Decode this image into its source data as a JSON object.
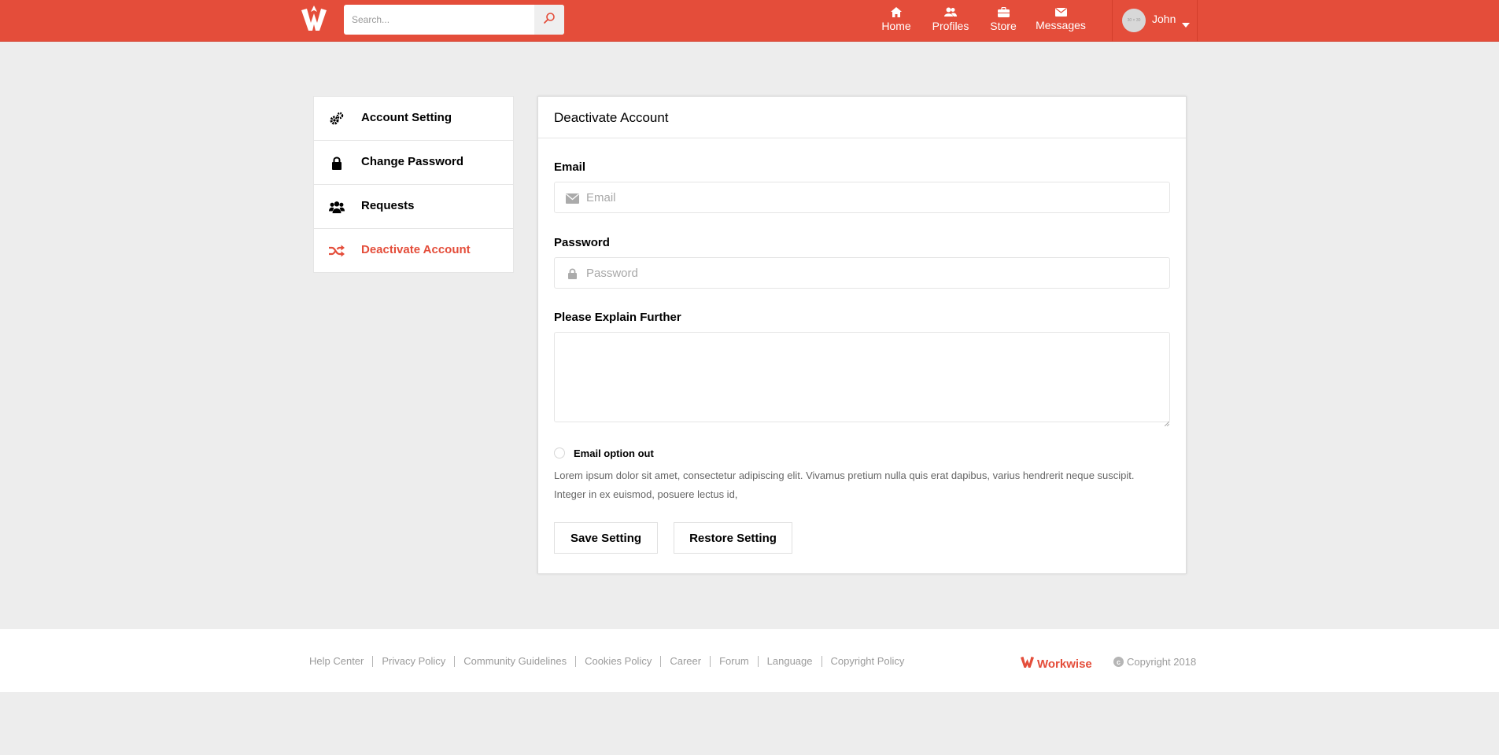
{
  "header": {
    "search_placeholder": "Search...",
    "nav": [
      {
        "label": "Home",
        "icon": "home-icon"
      },
      {
        "label": "Profiles",
        "icon": "profiles-icon"
      },
      {
        "label": "Store",
        "icon": "store-icon"
      },
      {
        "label": "Messages",
        "icon": "messages-icon"
      }
    ],
    "user": {
      "name": "John",
      "avatar_text": "30 × 30"
    },
    "accent_color": "#e44d3a"
  },
  "sidebar": {
    "items": [
      {
        "label": "Account Setting",
        "icon": "gears-icon",
        "active": false
      },
      {
        "label": "Change Password",
        "icon": "lock-icon",
        "active": false
      },
      {
        "label": "Requests",
        "icon": "users-icon",
        "active": false
      },
      {
        "label": "Deactivate Account",
        "icon": "random-icon",
        "active": true
      }
    ]
  },
  "card": {
    "title": "Deactivate Account",
    "email": {
      "label": "Email",
      "placeholder": "Email",
      "value": ""
    },
    "password": {
      "label": "Password",
      "placeholder": "Password",
      "value": ""
    },
    "explain": {
      "label": "Please Explain Further",
      "value": ""
    },
    "option": {
      "label": "Email option out",
      "checked": false
    },
    "description": "Lorem ipsum dolor sit amet, consectetur adipiscing elit. Vivamus pretium nulla quis erat dapibus, varius hendrerit neque suscipit. Integer in ex euismod, posuere lectus id,",
    "save_label": "Save Setting",
    "restore_label": "Restore Setting"
  },
  "footer": {
    "links": [
      "Help Center",
      "Privacy Policy",
      "Community Guidelines",
      "Cookies Policy",
      "Career",
      "Forum",
      "Language",
      "Copyright Policy"
    ],
    "brand": "Workwise",
    "copyright": "Copyright 2018"
  }
}
